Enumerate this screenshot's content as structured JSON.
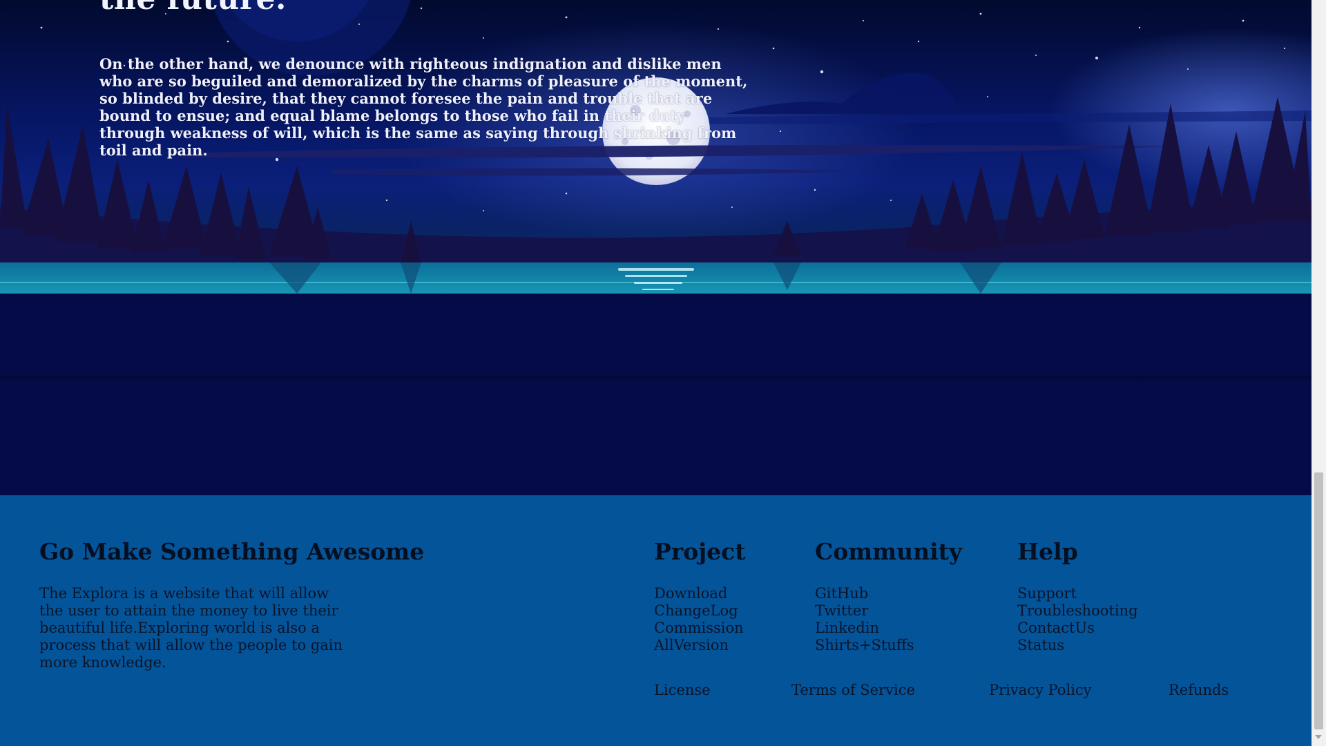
{
  "hero": {
    "heading": "the future.",
    "paragraph": "On the other hand, we denounce with righteous indignation and dislike men who are so beguiled and demoralized by the charms of pleasure of the moment, so blinded by desire, that they cannot foresee the pain and trouble that are bound to ensue; and equal blame belongs to those who fail in their duty through weakness of will, which is the same as saying through shrinking from toil and pain."
  },
  "footer": {
    "brand_title": "Go Make Something Awesome",
    "brand_text": "The Explora is a website that will allow the user to attain the money to live their beautiful life.Exploring world is also a process that will allow the people to gain more knowledge.",
    "columns": [
      {
        "title": "Project",
        "links": [
          "Download",
          "ChangeLog",
          "Commission",
          "AllVersion"
        ]
      },
      {
        "title": "Community",
        "links": [
          "GitHub",
          "Twitter",
          "Linkedin",
          "Shirts+Stuffs"
        ]
      },
      {
        "title": "Help",
        "links": [
          "Support",
          "Troubleshooting",
          "ContactUs",
          "Status"
        ]
      }
    ],
    "legal_links": [
      "License",
      "Terms of Service",
      "Privacy Policy",
      "Refunds"
    ]
  },
  "colors": {
    "band_background": "#050b46",
    "footer_background": "#04549a",
    "hero_text": "#eef0ff"
  }
}
